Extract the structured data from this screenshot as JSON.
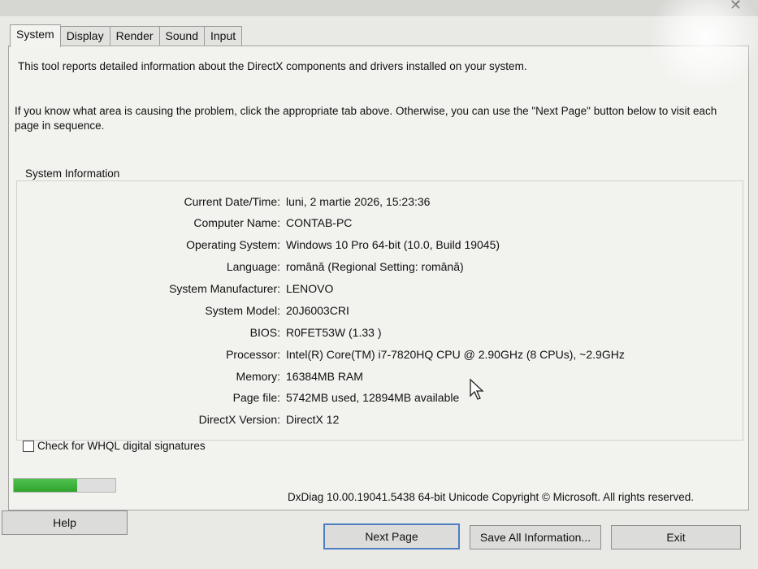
{
  "tabs": [
    "System",
    "Display",
    "Render",
    "Sound",
    "Input"
  ],
  "intro": {
    "line1": "This tool reports detailed information about the DirectX components and drivers installed on your system.",
    "line2": "If you know what area is causing the problem, click the appropriate tab above.  Otherwise, you can use the \"Next Page\" button below to visit each page in sequence."
  },
  "group_title": "System Information",
  "info": [
    {
      "label": "Current Date/Time:",
      "value": "luni, 2 martie 2026, 15:23:36"
    },
    {
      "label": "Computer Name:",
      "value": "CONTAB-PC"
    },
    {
      "label": "Operating System:",
      "value": "Windows 10 Pro 64-bit (10.0, Build 19045)"
    },
    {
      "label": "Language:",
      "value": "română (Regional Setting: română)"
    },
    {
      "label": "System Manufacturer:",
      "value": "LENOVO"
    },
    {
      "label": "System Model:",
      "value": "20J6003CRI"
    },
    {
      "label": "BIOS:",
      "value": "R0FET53W (1.33 )"
    },
    {
      "label": "Processor:",
      "value": "Intel(R) Core(TM) i7-7820HQ CPU @ 2.90GHz (8 CPUs), ~2.9GHz"
    },
    {
      "label": "Memory:",
      "value": "16384MB RAM"
    },
    {
      "label": "Page file:",
      "value": "5742MB used, 12894MB available"
    },
    {
      "label": "DirectX Version:",
      "value": "DirectX 12"
    }
  ],
  "whql_label": "Check for WHQL digital signatures",
  "progress_fraction": 0.62,
  "copyright": "DxDiag 10.00.19041.5438 64-bit Unicode  Copyright © Microsoft. All rights reserved.",
  "buttons": {
    "help": "Help",
    "next_page": "Next Page",
    "save_all": "Save All Information...",
    "exit": "Exit"
  },
  "colors": {
    "progress": "#2ea32e",
    "default_button_border": "#4d7ec2"
  }
}
